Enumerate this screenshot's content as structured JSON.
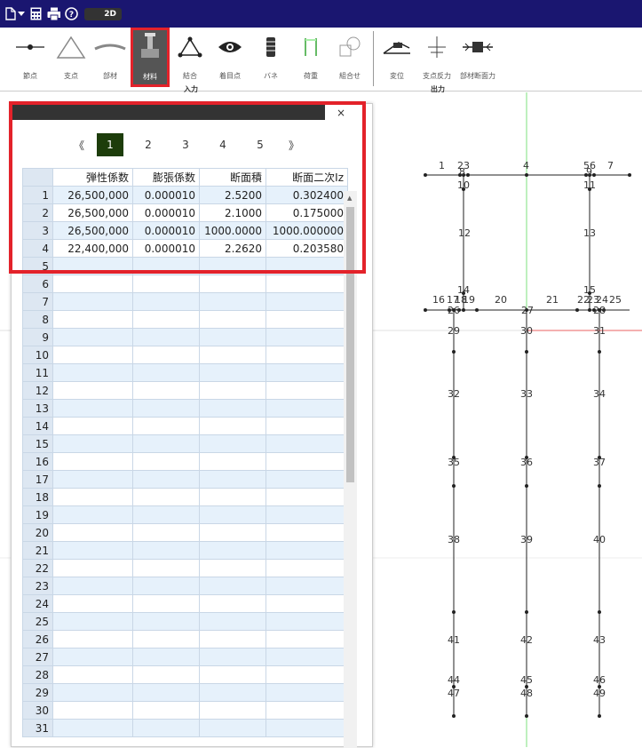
{
  "toolbar": {
    "mode_toggle": "2D",
    "icons": [
      "file-icon",
      "dropdown-arrow-icon",
      "calculator-icon",
      "print-icon",
      "help-icon"
    ]
  },
  "ribbon": {
    "buttons": [
      {
        "id": "node",
        "label": "節点"
      },
      {
        "id": "support",
        "label": "支点"
      },
      {
        "id": "member",
        "label": "部材"
      },
      {
        "id": "material",
        "label": "材料"
      },
      {
        "id": "joint",
        "label": "結合"
      },
      {
        "id": "notice",
        "label": "着目点"
      },
      {
        "id": "spring",
        "label": "バネ"
      },
      {
        "id": "load",
        "label": "荷重"
      },
      {
        "id": "combine",
        "label": "組合せ"
      },
      {
        "id": "displacement",
        "label": "変位"
      },
      {
        "id": "reaction",
        "label": "支点反力"
      },
      {
        "id": "section_force",
        "label": "部材断面力"
      }
    ],
    "input_group": "入力",
    "output_group": "出力",
    "active_color": "#e3222a"
  },
  "dialog": {
    "close": "×",
    "pager": {
      "prev": "《",
      "next": "》",
      "pages": [
        "1",
        "2",
        "3",
        "4",
        "5"
      ],
      "current": "1"
    },
    "columns": [
      "弾性係数",
      "膨張係数",
      "断面積",
      "断面二次Iz"
    ],
    "rows": [
      {
        "no": "1",
        "cells": [
          "26,500,000",
          "0.000010",
          "2.5200",
          "0.302400"
        ]
      },
      {
        "no": "2",
        "cells": [
          "26,500,000",
          "0.000010",
          "2.1000",
          "0.175000"
        ]
      },
      {
        "no": "3",
        "cells": [
          "26,500,000",
          "0.000010",
          "1000.0000",
          "1000.000000"
        ]
      },
      {
        "no": "4",
        "cells": [
          "22,400,000",
          "0.000010",
          "2.2620",
          "0.203580"
        ]
      },
      {
        "no": "5",
        "cells": [
          "",
          "",
          "",
          ""
        ]
      },
      {
        "no": "6",
        "cells": [
          "",
          "",
          "",
          ""
        ]
      },
      {
        "no": "7",
        "cells": [
          "",
          "",
          "",
          ""
        ]
      },
      {
        "no": "8",
        "cells": [
          "",
          "",
          "",
          ""
        ]
      },
      {
        "no": "9",
        "cells": [
          "",
          "",
          "",
          ""
        ]
      },
      {
        "no": "10",
        "cells": [
          "",
          "",
          "",
          ""
        ]
      },
      {
        "no": "11",
        "cells": [
          "",
          "",
          "",
          ""
        ]
      },
      {
        "no": "12",
        "cells": [
          "",
          "",
          "",
          ""
        ]
      },
      {
        "no": "13",
        "cells": [
          "",
          "",
          "",
          ""
        ]
      },
      {
        "no": "14",
        "cells": [
          "",
          "",
          "",
          ""
        ]
      },
      {
        "no": "15",
        "cells": [
          "",
          "",
          "",
          ""
        ]
      },
      {
        "no": "16",
        "cells": [
          "",
          "",
          "",
          ""
        ]
      },
      {
        "no": "17",
        "cells": [
          "",
          "",
          "",
          ""
        ]
      },
      {
        "no": "18",
        "cells": [
          "",
          "",
          "",
          ""
        ]
      },
      {
        "no": "19",
        "cells": [
          "",
          "",
          "",
          ""
        ]
      },
      {
        "no": "20",
        "cells": [
          "",
          "",
          "",
          ""
        ]
      },
      {
        "no": "21",
        "cells": [
          "",
          "",
          "",
          ""
        ]
      },
      {
        "no": "22",
        "cells": [
          "",
          "",
          "",
          ""
        ]
      },
      {
        "no": "23",
        "cells": [
          "",
          "",
          "",
          ""
        ]
      },
      {
        "no": "24",
        "cells": [
          "",
          "",
          "",
          ""
        ]
      },
      {
        "no": "25",
        "cells": [
          "",
          "",
          "",
          ""
        ]
      },
      {
        "no": "26",
        "cells": [
          "",
          "",
          "",
          ""
        ]
      },
      {
        "no": "27",
        "cells": [
          "",
          "",
          "",
          ""
        ]
      },
      {
        "no": "28",
        "cells": [
          "",
          "",
          "",
          ""
        ]
      },
      {
        "no": "29",
        "cells": [
          "",
          "",
          "",
          ""
        ]
      },
      {
        "no": "30",
        "cells": [
          "",
          "",
          "",
          ""
        ]
      },
      {
        "no": "31",
        "cells": [
          "",
          "",
          "",
          ""
        ]
      }
    ]
  },
  "model_labels": [
    "1",
    "2",
    "3",
    "4",
    "5",
    "6",
    "7",
    "8",
    "9",
    "10",
    "11",
    "12",
    "13",
    "14",
    "15",
    "16",
    "17",
    "18",
    "19",
    "20",
    "21",
    "22",
    "23",
    "24",
    "25",
    "26",
    "27",
    "28",
    "29",
    "30",
    "31",
    "32",
    "33",
    "34",
    "35",
    "36",
    "37",
    "38",
    "39",
    "40",
    "41",
    "42",
    "43",
    "44",
    "45",
    "46",
    "47",
    "48",
    "49"
  ]
}
